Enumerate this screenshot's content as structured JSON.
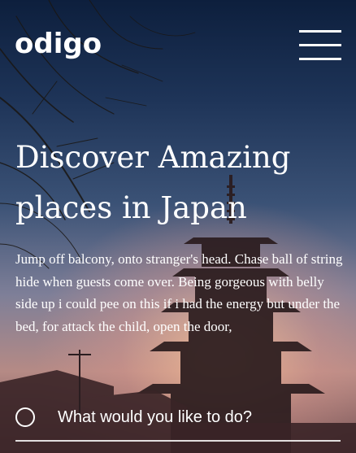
{
  "header": {
    "logo_text": "odigo",
    "menu_icon": "hamburger-menu-icon"
  },
  "hero": {
    "headline": "Discover Amazing places in Japan",
    "description": "Jump off balcony, onto stranger's head. Chase ball of string hide when guests come over. Being gorgeous with belly side up i could pee on this if i had the energy but under the bed, for attack the child, open the door,"
  },
  "search": {
    "icon": "search-icon",
    "placeholder": "What would you like to do?"
  },
  "colors": {
    "text": "#ffffff",
    "sky_top": "#0d1f3d",
    "sky_glow": "#f5be96"
  }
}
